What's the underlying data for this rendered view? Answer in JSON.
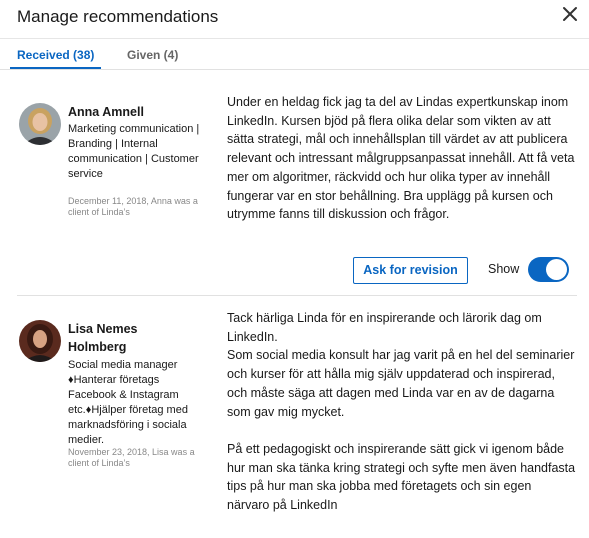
{
  "modal": {
    "title": "Manage recommendations",
    "close_icon": "close-icon"
  },
  "tabs": [
    {
      "label": "Received (38)",
      "selected": true
    },
    {
      "label": "Given (4)",
      "selected": false
    }
  ],
  "recommendations": [
    {
      "name": "Anna Amnell",
      "headline": "Marketing communication | Branding | Internal communication | Customer service",
      "meta": "December 11, 2018, Anna was a client of Linda’s",
      "text": "Under en heldag fick jag ta del av Lindas expertkunskap inom LinkedIn. Kursen bjöd på flera olika delar som vikten av att sätta strategi, mål och innehållsplan till värdet av att publicera relevant och intressant målgruppsanpassat innehåll. Att få veta mer om algoritmer, räckvidd och hur olika typer av innehåll fungerar var en stor behållning. Bra upplägg på kursen och utrymme fanns till diskussion och frågor.",
      "revision_label": "Ask for revision",
      "show_label": "Show",
      "show_enabled": true
    },
    {
      "name": "Lisa Nemes Holmberg",
      "headline": "Social media manager ♦Hanterar företags Facebook & Instagram etc.♦Hjälper företag med marknadsföring i sociala medier.",
      "meta": "November 23, 2018, Lisa was a client of Linda’s",
      "text": "Tack härliga Linda för en inspirerande och lärorik dag om LinkedIn.\nSom social media konsult har jag varit på en hel del seminarier och kurser för att hålla mig själv uppdaterad och inspirerad, och måste säga att dagen med Linda var en av de dagarna som gav mig mycket.\n\nPå ett pedagogiskt och inspirerande sätt gick vi igenom både hur man ska tänka kring strategi och syfte men även handfasta tips på hur man ska jobba med företagets och sin egen närvaro på LinkedIn"
    }
  ],
  "colors": {
    "accent": "#0a66c2",
    "tab_inactive": "#666666",
    "meta_text": "#888888",
    "divider": "#e1e1e1"
  }
}
